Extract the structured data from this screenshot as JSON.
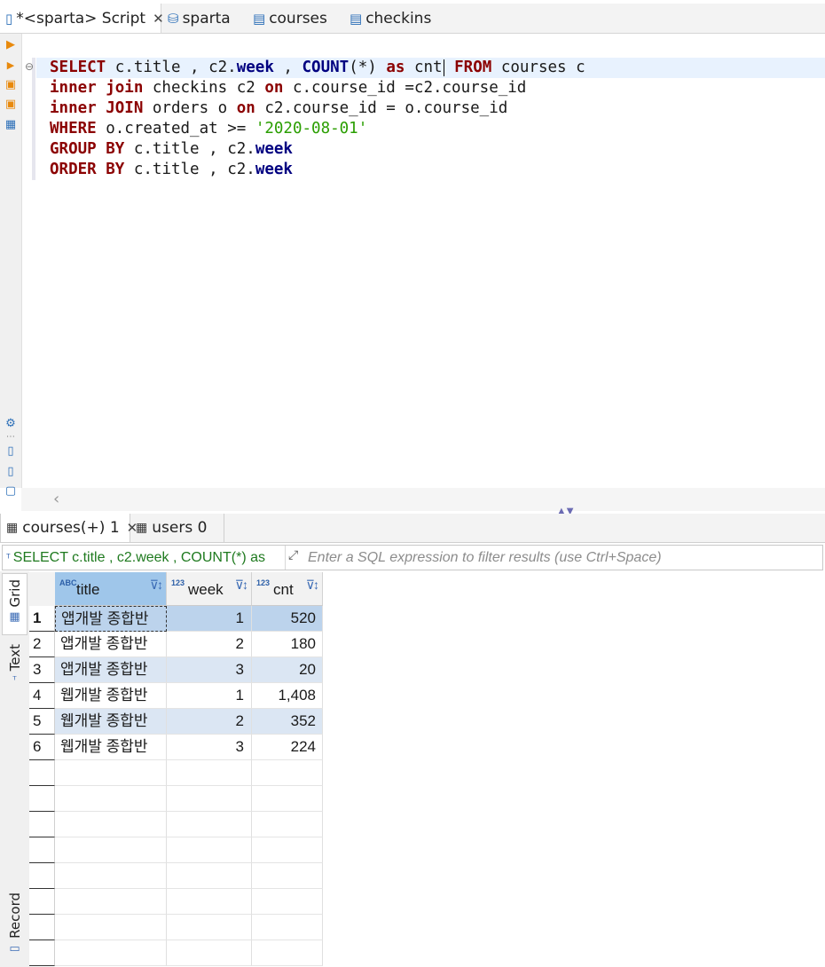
{
  "editor_tabs": [
    {
      "label": "*<sparta> Script",
      "icon": "sql-script-icon",
      "active": true
    },
    {
      "label": "sparta",
      "icon": "database-icon"
    },
    {
      "label": "courses",
      "icon": "table-icon"
    },
    {
      "label": "checkins",
      "icon": "table-icon"
    }
  ],
  "sql": {
    "lines": [
      [
        [
          "kw",
          "SELECT"
        ],
        [
          "t",
          " c.title , c2."
        ],
        [
          "fn",
          "week"
        ],
        [
          "t",
          " , "
        ],
        [
          "fn",
          "COUNT"
        ],
        [
          "t",
          "(*) "
        ],
        [
          "kw",
          "as"
        ],
        [
          "t",
          " cnt"
        ],
        [
          "cursor",
          ""
        ],
        [
          "t",
          " "
        ],
        [
          "kw",
          "FROM"
        ],
        [
          "t",
          " courses c"
        ]
      ],
      [
        [
          "kw",
          "inner join"
        ],
        [
          "t",
          " checkins c2 "
        ],
        [
          "kw",
          "on"
        ],
        [
          "t",
          " c.course_id =c2.course_id"
        ]
      ],
      [
        [
          "kw",
          "inner JOIN"
        ],
        [
          "t",
          " orders o "
        ],
        [
          "kw",
          "on"
        ],
        [
          "t",
          " c2.course_id = o.course_id"
        ]
      ],
      [
        [
          "kw",
          "WHERE"
        ],
        [
          "t",
          " o.created_at >= "
        ],
        [
          "str",
          "'2020-08-01'"
        ]
      ],
      [
        [
          "kw",
          "GROUP BY"
        ],
        [
          "t",
          " c.title , c2."
        ],
        [
          "fn",
          "week"
        ]
      ],
      [
        [
          "kw",
          "ORDER BY"
        ],
        [
          "t",
          " c.title , c2."
        ],
        [
          "fn",
          "week"
        ]
      ]
    ]
  },
  "result_tabs": [
    {
      "label": "courses(+) 1",
      "active": true
    },
    {
      "label": "users 0"
    }
  ],
  "filter": {
    "query_label": "SELECT c.title , c2.week , COUNT(*) as",
    "placeholder": "Enter a SQL expression to filter results (use Ctrl+Space)"
  },
  "side_tabs": {
    "grid": "Grid",
    "text": "Text",
    "record": "Record"
  },
  "grid": {
    "columns": [
      {
        "name": "title",
        "type": "ABC"
      },
      {
        "name": "week",
        "type": "123"
      },
      {
        "name": "cnt",
        "type": "123"
      }
    ],
    "rows": [
      {
        "n": "1",
        "title": "앱개발 종합반",
        "week": "1",
        "cnt": "520"
      },
      {
        "n": "2",
        "title": "앱개발 종합반",
        "week": "2",
        "cnt": "180"
      },
      {
        "n": "3",
        "title": "앱개발 종합반",
        "week": "3",
        "cnt": "20"
      },
      {
        "n": "4",
        "title": "웹개발 종합반",
        "week": "1",
        "cnt": "1,408"
      },
      {
        "n": "5",
        "title": "웹개발 종합반",
        "week": "2",
        "cnt": "352"
      },
      {
        "n": "6",
        "title": "웹개발 종합반",
        "week": "3",
        "cnt": "224"
      }
    ]
  },
  "colors": {
    "keyword": "#8b0000",
    "function": "#000080",
    "string": "#2a9e00",
    "selection": "#bcd3ec",
    "alt_row": "#dbe6f3"
  }
}
